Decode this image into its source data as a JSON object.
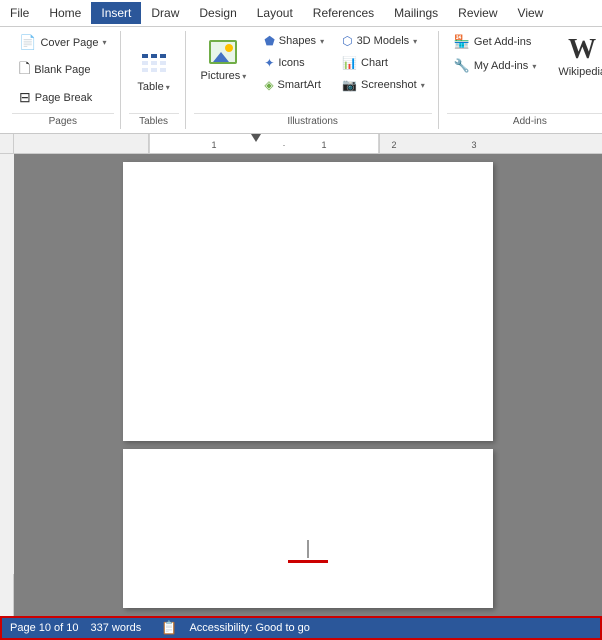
{
  "menu": {
    "items": [
      {
        "label": "File",
        "active": false
      },
      {
        "label": "Home",
        "active": false
      },
      {
        "label": "Insert",
        "active": true
      },
      {
        "label": "Draw",
        "active": false
      },
      {
        "label": "Design",
        "active": false
      },
      {
        "label": "Layout",
        "active": false
      },
      {
        "label": "References",
        "active": false
      },
      {
        "label": "Mailings",
        "active": false
      },
      {
        "label": "Review",
        "active": false
      },
      {
        "label": "View",
        "active": false
      }
    ]
  },
  "ribbon": {
    "groups": [
      {
        "name": "Pages",
        "items": [
          {
            "label": "Cover Page",
            "dropdown": true
          },
          {
            "label": "Blank Page"
          },
          {
            "label": "Page Break"
          }
        ]
      },
      {
        "name": "Tables",
        "items": [
          {
            "label": "Table",
            "dropdown": true
          }
        ]
      },
      {
        "name": "Illustrations",
        "items": [
          {
            "label": "Pictures",
            "dropdown": true
          },
          {
            "label": "Shapes",
            "dropdown": true
          },
          {
            "label": "Icons"
          },
          {
            "label": "SmartArt"
          },
          {
            "label": "3D Models",
            "dropdown": true
          },
          {
            "label": "Chart"
          },
          {
            "label": "Screenshot",
            "dropdown": true
          }
        ]
      },
      {
        "name": "Add-ins",
        "items": [
          {
            "label": "Get Add-ins"
          },
          {
            "label": "My Add-ins",
            "dropdown": true
          },
          {
            "label": "Wikipedia"
          }
        ]
      }
    ]
  },
  "statusBar": {
    "pageInfo": "Page 10 of 10",
    "wordCount": "337 words",
    "proofing": "Accessibility: Good to go"
  }
}
